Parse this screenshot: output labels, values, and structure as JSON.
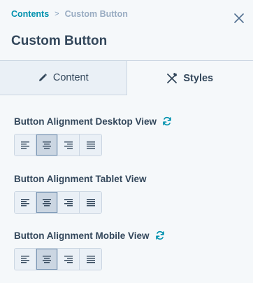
{
  "breadcrumb": {
    "parent": "Contents",
    "separator": ">",
    "current": "Custom Button"
  },
  "panel": {
    "title": "Custom Button",
    "close_icon": "close-icon"
  },
  "tabs": [
    {
      "label": "Content",
      "icon": "pencil-icon",
      "active": false
    },
    {
      "label": "Styles",
      "icon": "styles-icon",
      "active": true
    }
  ],
  "sections": [
    {
      "label": "Button Alignment Desktop View",
      "has_sync_icon": true,
      "selected": "center"
    },
    {
      "label": "Button Alignment Tablet View",
      "has_sync_icon": false,
      "selected": "center"
    },
    {
      "label": "Button Alignment Mobile View",
      "has_sync_icon": true,
      "selected": "center"
    }
  ],
  "alignment_options": [
    "left",
    "center",
    "right",
    "justify"
  ],
  "colors": {
    "accent": "#0091ae",
    "text": "#33475b",
    "border": "#cbd6e2",
    "background": "#f5f8fa"
  }
}
